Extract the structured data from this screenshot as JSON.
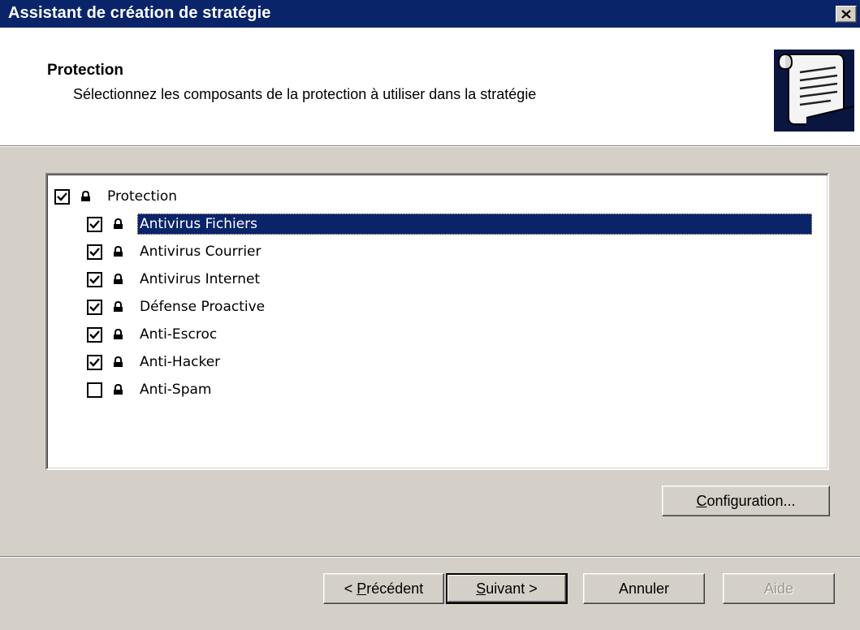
{
  "window": {
    "title": "Assistant de création de stratégie",
    "close_icon": "close-icon"
  },
  "header": {
    "title": "Protection",
    "subtitle": "Sélectionnez les composants de la protection à utiliser dans la stratégie",
    "icon": "scroll-document-icon"
  },
  "tree": {
    "root": {
      "label": "Protection",
      "checked": true
    },
    "items": [
      {
        "label": "Antivirus Fichiers",
        "checked": true,
        "selected": true
      },
      {
        "label": "Antivirus Courrier",
        "checked": true,
        "selected": false
      },
      {
        "label": "Antivirus Internet",
        "checked": true,
        "selected": false
      },
      {
        "label": "Défense Proactive",
        "checked": true,
        "selected": false
      },
      {
        "label": "Anti-Escroc",
        "checked": true,
        "selected": false
      },
      {
        "label": "Anti-Hacker",
        "checked": true,
        "selected": false
      },
      {
        "label": "Anti-Spam",
        "checked": false,
        "selected": false
      }
    ]
  },
  "buttons": {
    "configuration": {
      "mnemonic": "C",
      "rest": "onfiguration..."
    },
    "previous": {
      "prefix": "< ",
      "mnemonic": "P",
      "rest": "récédent"
    },
    "next": {
      "mnemonic": "S",
      "rest": "uivant >"
    },
    "cancel": "Annuler",
    "help": "Aide"
  },
  "colors": {
    "titlebar": "#0a246a",
    "selection": "#0a246a",
    "face": "#d4d0c8"
  }
}
